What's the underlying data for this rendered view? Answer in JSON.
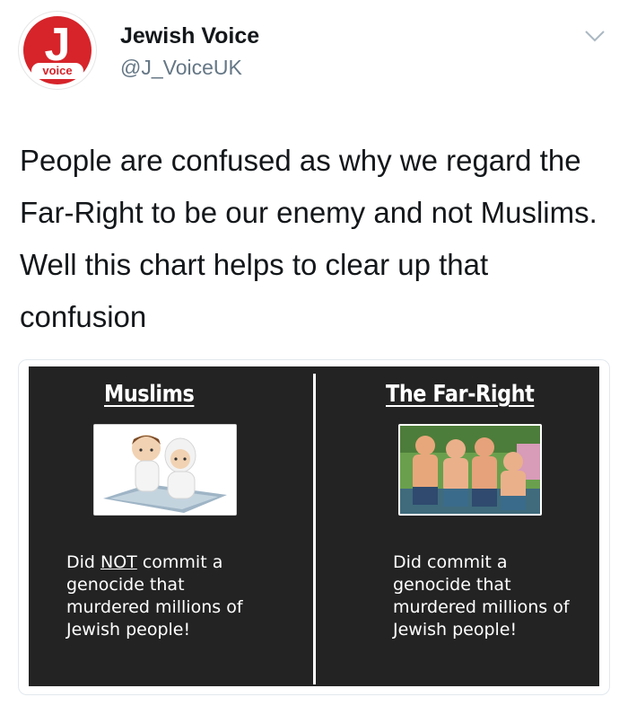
{
  "tweet": {
    "author_name": "Jewish Voice",
    "author_handle": "@J_VoiceUK",
    "avatar_letter": "J",
    "avatar_badge": "voice",
    "text": "People are confused as why we regard the Far-Right to be our enemy and not Muslims. Well this chart helps to clear up that confusion"
  },
  "image": {
    "left": {
      "title": "Muslims",
      "line1_before": "Did ",
      "line1_emph": "NOT",
      "line1_after": " commit a",
      "line2": "genocide that",
      "line3": "murdered millions of",
      "line4": "Jewish people!"
    },
    "right": {
      "title": "The Far-Right",
      "line1": "Did commit a",
      "line2": "genocide that",
      "line3": "murdered millions of",
      "line4": "Jewish people!"
    }
  },
  "colors": {
    "brand_red": "#d6242a",
    "panel_bg": "#232323",
    "handle_gray": "#657786"
  },
  "icons": {
    "menu": "chevron-down-icon"
  }
}
